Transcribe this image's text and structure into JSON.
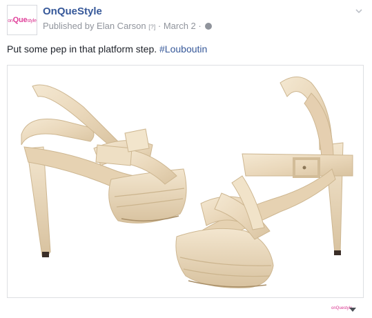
{
  "post": {
    "avatar_logo_prefix": "on",
    "avatar_logo_big": "Que",
    "avatar_logo_suffix": "style",
    "page_name": "OnQueStyle",
    "published_by": "Published by Elan Carson",
    "help_marker": "[?]",
    "separator": "·",
    "date": "March 2",
    "privacy_icon": "globe-icon",
    "menu_icon": "chevron-down-icon",
    "caption_text": "Put some pep in that platform step. ",
    "caption_hashtag": "#Louboutin",
    "footer_logo": "onQuestyle",
    "footer_menu_icon": "triangle-down-icon"
  },
  "colors": {
    "link_blue": "#365899",
    "meta_gray": "#90949c",
    "text_dark": "#1d2129",
    "brand_pink": "#d9318e",
    "shoe_cream": "#ecdcc0"
  }
}
